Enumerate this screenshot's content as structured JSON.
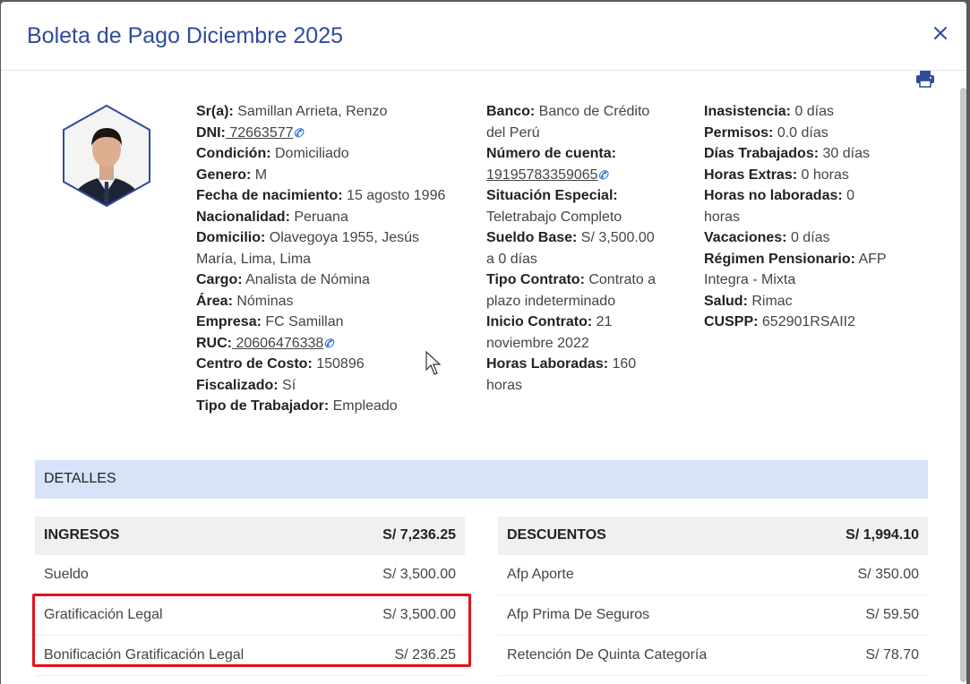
{
  "modal": {
    "title": "Boleta de Pago Diciembre 2025"
  },
  "employee": {
    "col1": [
      {
        "label": "Sr(a):",
        "value": " Samillan Arrieta, Renzo"
      },
      {
        "label": "DNI:",
        "value": " 72663577",
        "link": true,
        "phone": true
      },
      {
        "label": "Condición:",
        "value": " Domiciliado"
      },
      {
        "label": "Genero:",
        "value": " M"
      },
      {
        "label": "Fecha de nacimiento:",
        "value": " 15 agosto 1996"
      },
      {
        "label": "Nacionalidad:",
        "value": " Peruana"
      },
      {
        "label": "Domicilio:",
        "value": " Olavegoya 1955, Jesús",
        "cont": "María, Lima, Lima"
      },
      {
        "label": "Cargo:",
        "value": " Analista de Nómina"
      },
      {
        "label": "Área:",
        "value": " Nóminas"
      },
      {
        "label": "Empresa:",
        "value": " FC Samillan"
      },
      {
        "label": "RUC:",
        "value": " 20606476338",
        "link": true,
        "phone": true
      },
      {
        "label": "Centro de Costo:",
        "value": " 150896"
      },
      {
        "label": "Fiscalizado:",
        "value": " Sí"
      },
      {
        "label": "Tipo de Trabajador:",
        "value": " Empleado"
      }
    ],
    "col2": [
      {
        "label": "Banco:",
        "value": " Banco de Crédito",
        "cont": "del Perú"
      },
      {
        "label": "Número de cuenta:",
        "value": "",
        "cont_link": "19195783359065"
      },
      {
        "label": "Situación Especial:",
        "value": "",
        "cont": "Teletrabajo Completo"
      },
      {
        "label": "Sueldo Base:",
        "value": " S/ 3,500.00",
        "cont": "a 0 días"
      },
      {
        "label": "Tipo Contrato:",
        "value": " Contrato a",
        "cont": "plazo indeterminado"
      },
      {
        "label": "Inicio Contrato:",
        "value": " 21",
        "cont": "noviembre 2022"
      },
      {
        "label": "Horas Laboradas:",
        "value": " 160",
        "cont": "horas"
      }
    ],
    "col3": [
      {
        "label": "Inasistencia:",
        "value": " 0 días"
      },
      {
        "label": "Permisos:",
        "value": " 0.0 días"
      },
      {
        "label": "Días Trabajados:",
        "value": " 30 días"
      },
      {
        "label": "Horas Extras:",
        "value": " 0 horas"
      },
      {
        "label": "Horas no laboradas:",
        "value": " 0",
        "cont": "horas"
      },
      {
        "label": "Vacaciones:",
        "value": " 0 días"
      },
      {
        "label": "Régimen Pensionario:",
        "value": " AFP",
        "cont": "Integra - Mixta"
      },
      {
        "label": "Salud:",
        "value": " Rimac"
      },
      {
        "label": "CUSPP:",
        "value": " 652901RSAII2"
      }
    ]
  },
  "detalles": {
    "label": "DETALLES"
  },
  "ingresos": {
    "title": "INGRESOS",
    "total": "S/ 7,236.25",
    "rows": [
      {
        "concept": "Sueldo",
        "amount": "S/ 3,500.00"
      },
      {
        "concept": "Gratificación Legal",
        "amount": "S/ 3,500.00"
      },
      {
        "concept": "Bonificación Gratificación Legal",
        "amount": "S/ 236.25"
      }
    ]
  },
  "descuentos": {
    "title": "DESCUENTOS",
    "total": "S/ 1,994.10",
    "rows": [
      {
        "concept": "Afp Aporte",
        "amount": "S/ 350.00"
      },
      {
        "concept": "Afp Prima De Seguros",
        "amount": "S/ 59.50"
      },
      {
        "concept": "Retención De Quinta Categoría",
        "amount": "S/ 78.70"
      }
    ]
  },
  "colors": {
    "title": "#2f4b9c",
    "highlight": "#e0141b",
    "detalles_bg": "#d8e2f8",
    "phone": "#2d7be0"
  }
}
